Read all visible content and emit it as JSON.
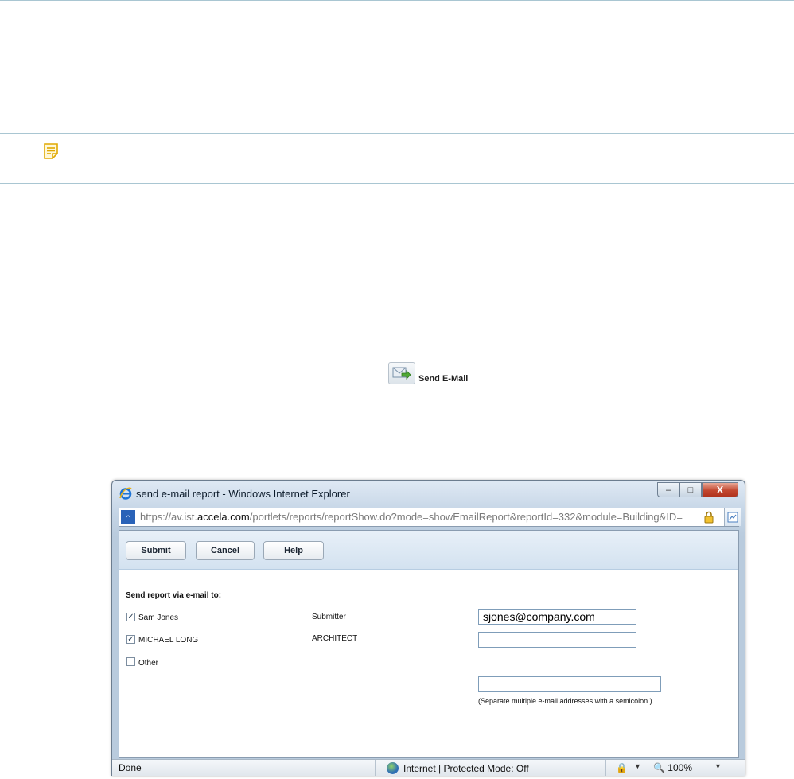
{
  "send_email": {
    "label": "Send E-Mail"
  },
  "window": {
    "title": "send e-mail report - Windows Internet Explorer",
    "url_prefix": "https://av.ist.",
    "url_domain": "accela.com",
    "url_rest": "/portlets/reports/reportShow.do?mode=showEmailReport&reportId=332&module=Building&ID=",
    "buttons": {
      "minimize": "–",
      "maximize": "□",
      "close": "X"
    }
  },
  "toolbar": {
    "submit": "Submit",
    "cancel": "Cancel",
    "help": "Help"
  },
  "form": {
    "heading": "Send report via e-mail to:",
    "recipients": [
      {
        "name": "Sam Jones",
        "role": "Submitter",
        "checked": true,
        "email": "sjones@company.com"
      },
      {
        "name": "MICHAEL LONG",
        "role": "ARCHITECT",
        "checked": true,
        "email": ""
      },
      {
        "name": "Other",
        "role": "",
        "checked": false,
        "email": ""
      }
    ],
    "hint": "(Separate multiple e-mail addresses with a semicolon.)"
  },
  "status_bar": {
    "status": "Done",
    "zone": "Internet | Protected Mode: Off",
    "zoom": "100%"
  }
}
